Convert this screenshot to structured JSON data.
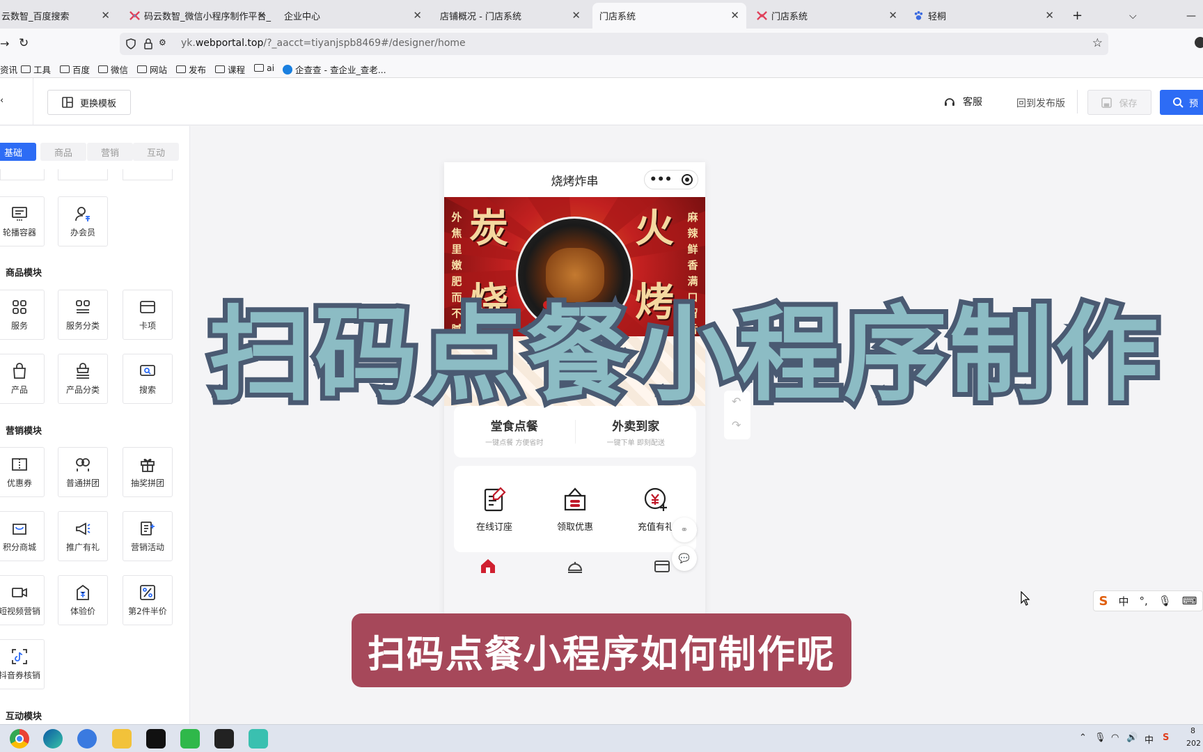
{
  "browser": {
    "tabs": [
      {
        "label": "云数智_百度搜索",
        "icon": "baidu-icon"
      },
      {
        "label": "码云数智_微信小程序制作平台_",
        "icon": "mayun-icon"
      },
      {
        "label": "企业中心",
        "icon": "none"
      },
      {
        "label": "店铺概况 - 门店系统",
        "icon": "none"
      },
      {
        "label": "门店系统",
        "icon": "none",
        "active": true
      },
      {
        "label": "门店系统",
        "icon": "mayun-icon"
      },
      {
        "label": "轻桐",
        "icon": "paw-icon"
      }
    ],
    "url_prefix": "yk.",
    "url_domain": "webportal.top",
    "url_rest": "/?_aacct=tiyanjspb8469#/designer/home",
    "bookmarks": [
      "资讯",
      "工具",
      "百度",
      "微信",
      "网站",
      "发布",
      "课程",
      "ai",
      "企查查 - 查企业_查老..."
    ]
  },
  "appbar": {
    "switch_template": "更换模板",
    "service": "客服",
    "back_release": "回到发布版",
    "save": "保存",
    "preview": "预"
  },
  "sidebar": {
    "categories": [
      "基础",
      "商品",
      "营销",
      "互动"
    ],
    "basic_items": [
      "轮播容器",
      "办会员"
    ],
    "goods_title": "商品模块",
    "goods_items": [
      "服务",
      "服务分类",
      "卡项",
      "产品",
      "产品分类",
      "搜索"
    ],
    "marketing_title": "营销模块",
    "marketing_items": [
      "优惠券",
      "普通拼团",
      "抽奖拼团",
      "积分商城",
      "推广有礼",
      "营销活动",
      "短视频营销",
      "体验价",
      "第2件半价",
      "抖音券核销"
    ],
    "interact_title": "互动模块"
  },
  "phone": {
    "title": "烧烤炸串",
    "banner_big": [
      "炭",
      "烧",
      "火",
      "烤"
    ],
    "banner_left": "外焦里嫩 肥而不腻",
    "banner_right": "麻辣鲜香 满口留香",
    "order_dine": "堂食点餐",
    "order_dine_sub": "一键点餐 方便省时",
    "order_takeout": "外卖到家",
    "order_takeout_sub": "一键下单 即刻配送",
    "quick": [
      "在线订座",
      "领取优惠",
      "充值有礼"
    ]
  },
  "overlay": {
    "headline": "扫码点餐小程序制作",
    "subtitle": "扫码点餐小程序如何制作呢"
  },
  "ime": {
    "mode": "中"
  },
  "taskbar": {
    "tray_lang": "中",
    "clock_top": "8",
    "clock_bottom": "202"
  },
  "colors": {
    "accent": "#2d6cf5",
    "subtitle_bg": "#a6485a",
    "overlay_fill": "#8cbcc4",
    "overlay_stroke": "#4a5a72",
    "brand_red": "#c22020"
  }
}
